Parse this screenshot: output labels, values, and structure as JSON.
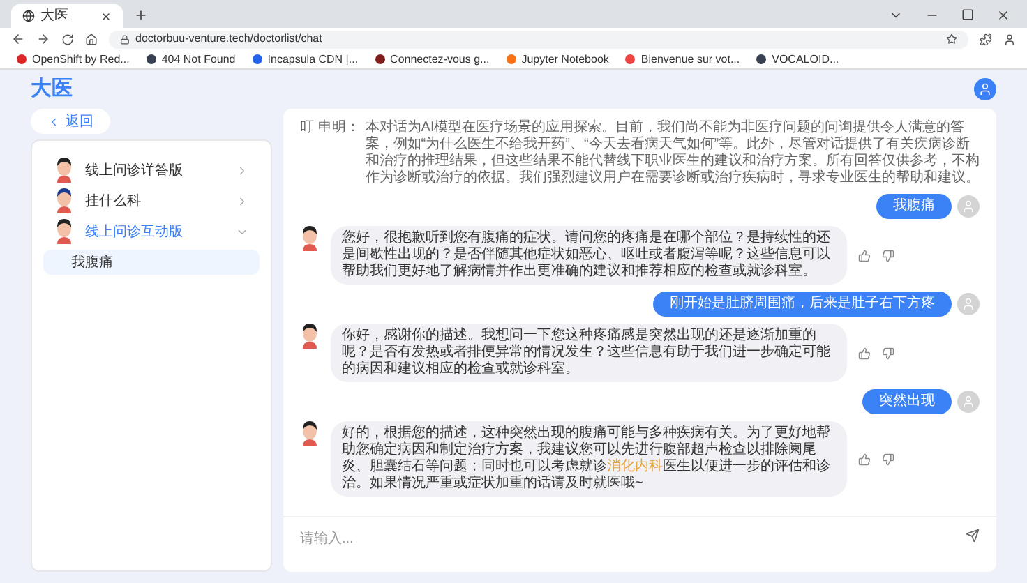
{
  "browser": {
    "tab_title": "大医",
    "url": "doctorbuu-venture.tech/doctorlist/chat",
    "bookmarks": [
      {
        "label": "OpenShift by Red...",
        "color": "#dc2626"
      },
      {
        "label": "404 Not Found",
        "color": "#374151"
      },
      {
        "label": "Incapsula CDN |...",
        "color": "#2563eb"
      },
      {
        "label": "Connectez-vous g...",
        "color": "#7f1d1d"
      },
      {
        "label": "Jupyter Notebook",
        "color": "#f97316"
      },
      {
        "label": "Bienvenue sur vot...",
        "color": "#ef4444"
      },
      {
        "label": "VOCALOID...",
        "color": "#374151"
      }
    ]
  },
  "app": {
    "logo": "大医",
    "back_label": "返回",
    "menu": [
      {
        "label": "线上问诊详答版",
        "expanded": false,
        "selected": false
      },
      {
        "label": "挂什么科",
        "expanded": false,
        "selected": false
      },
      {
        "label": "线上问诊互动版",
        "expanded": true,
        "selected": true,
        "children": [
          {
            "label": "我腹痛",
            "selected": true
          }
        ]
      }
    ]
  },
  "chat": {
    "disclaimer_label": "叮 申明：",
    "disclaimer": "本对话为AI模型在医疗场景的应用探索。目前，我们尚不能为非医疗问题的问询提供令人满意的答案，例如“为什么医生不给我开药”、“今天去看病天气如何”等。此外，尽管对话提供了有关疾病诊断和治疗的推理结果，但这些结果不能代替线下职业医生的建议和治疗方案。所有回答仅供参考，不构作为诊断或治疗的依据。我们强烈建议用户在需要诊断或治疗疾病时，寻求专业医生的帮助和建议。",
    "messages": [
      {
        "kind": "user",
        "text": "我腹痛"
      },
      {
        "kind": "bot",
        "text": "您好，很抱歉听到您有腹痛的症状。请问您的疼痛是在哪个部位？是持续性的还是间歇性出现的？是否伴随其他症状如恶心、呕吐或者腹泻等呢？这些信息可以帮助我们更好地了解病情并作出更准确的建议和推荐相应的检查或就诊科室。"
      },
      {
        "kind": "user",
        "text": "刚开始是肚脐周围痛，后来是肚子右下方疼"
      },
      {
        "kind": "bot",
        "text": "你好，感谢你的描述。我想问一下您这种疼痛感是突然出现的还是逐渐加重的呢？是否有发热或者排便异常的情况发生？这些信息有助于我们进一步确定可能的病因和建议相应的检查或就诊科室。"
      },
      {
        "kind": "user",
        "text": "突然出现"
      },
      {
        "kind": "bot",
        "text": "好的，根据您的描述，这种突然出现的腹痛可能与多种疾病有关。为了更好地帮助您确定病因和制定治疗方案，我建议您可以先进行腹部超声检查以排除阑尾炎、胆囊结石等问题；同时也可以考虑就诊**消化内科**医生以便进一步的评估和诊治。如果情况严重或症状加重的话请及时就医哦~"
      }
    ],
    "input": {
      "placeholder": "请输入..."
    }
  }
}
